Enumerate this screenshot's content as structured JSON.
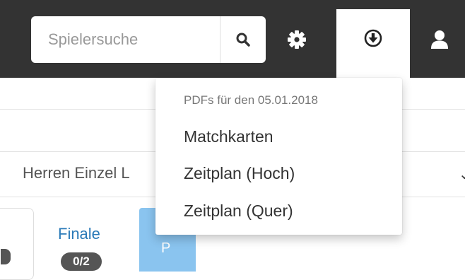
{
  "topbar": {
    "search": {
      "placeholder": "Spielersuche"
    },
    "icons": {
      "search": "search-icon",
      "settings": "gear-icon",
      "download": "download-circle-icon",
      "user": "user-icon"
    }
  },
  "dropdown": {
    "header": "PDFs für den 05.01.2018",
    "items": [
      {
        "label": "Matchkarten"
      },
      {
        "label": "Zeitplan (Hoch)"
      },
      {
        "label": "Zeitplan (Quer)"
      }
    ]
  },
  "filter": {
    "selected": "Herren Einzel L"
  },
  "rounds": {
    "finale": {
      "label": "Finale",
      "badge": "0/2"
    },
    "next": {
      "label": "P"
    }
  },
  "colors": {
    "topbar": "#333333",
    "accent_link": "#2a7ab8",
    "active_card": "#8ac4ef"
  }
}
